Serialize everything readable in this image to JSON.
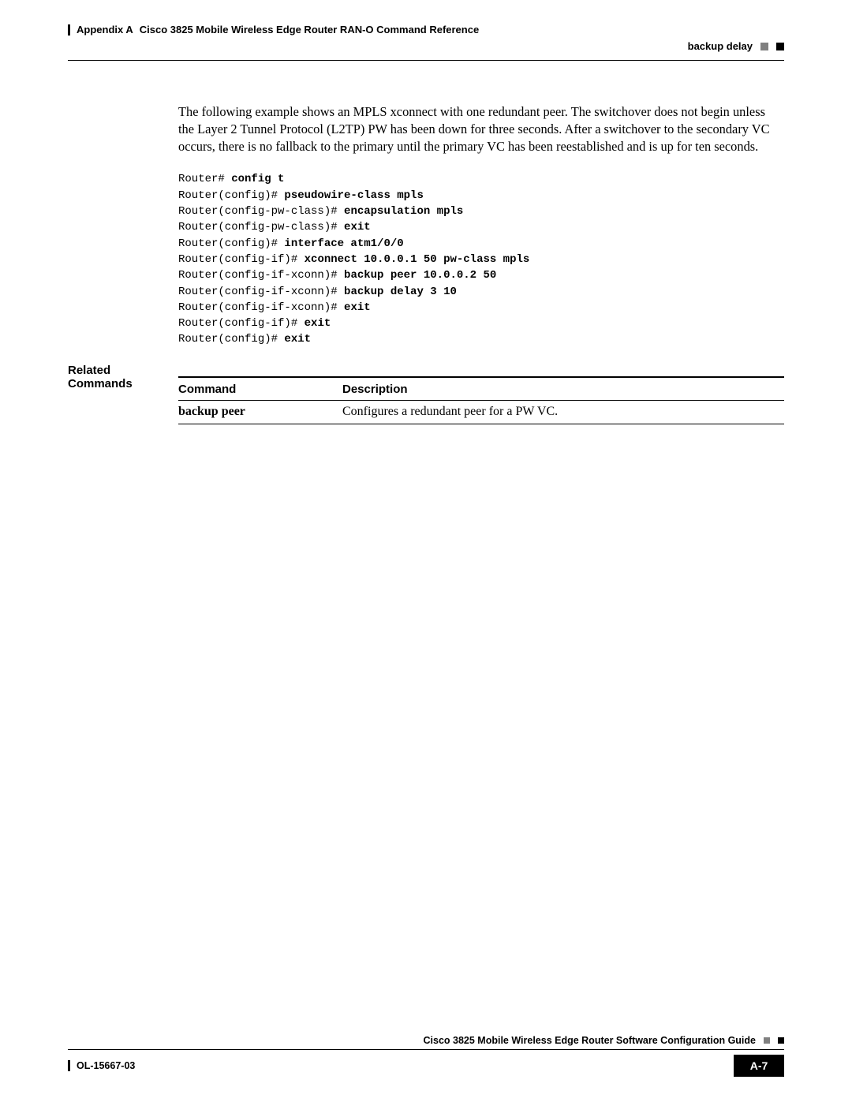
{
  "header": {
    "appendix": "Appendix A",
    "title": "Cisco 3825 Mobile Wireless Edge Router RAN-O Command Reference",
    "section": "backup delay"
  },
  "body": {
    "paragraph": "The following example shows an MPLS xconnect with one redundant peer. The switchover does not begin unless the Layer 2 Tunnel Protocol (L2TP) PW has been down for three seconds. After a switchover to the secondary VC occurs, there is no fallback to the primary until the primary VC has been reestablished and is up for ten seconds.",
    "code_lines": [
      {
        "prompt": "Router# ",
        "cmd": "config t"
      },
      {
        "prompt": "Router(config)# ",
        "cmd": "pseudowire-class mpls"
      },
      {
        "prompt": "Router(config-pw-class)# ",
        "cmd": "encapsulation mpls"
      },
      {
        "prompt": "Router(config-pw-class)# ",
        "cmd": "exit"
      },
      {
        "prompt": "Router(config)# ",
        "cmd": "interface atm1/0/0"
      },
      {
        "prompt": "Router(config-if)# ",
        "cmd": "xconnect 10.0.0.1 50 pw-class mpls"
      },
      {
        "prompt": "Router(config-if-xconn)# ",
        "cmd": "backup peer 10.0.0.2 50"
      },
      {
        "prompt": "Router(config-if-xconn)# ",
        "cmd": "backup delay 3 10"
      },
      {
        "prompt": "Router(config-if-xconn)# ",
        "cmd": "exit"
      },
      {
        "prompt": "Router(config-if)# ",
        "cmd": "exit"
      },
      {
        "prompt": "Router(config)# ",
        "cmd": "exit"
      }
    ],
    "related_label": "Related Commands",
    "table": {
      "head_command": "Command",
      "head_description": "Description",
      "rows": [
        {
          "command": "backup peer",
          "description": "Configures a redundant peer for a PW VC."
        }
      ]
    }
  },
  "footer": {
    "guide": "Cisco 3825 Mobile Wireless Edge Router Software Configuration Guide",
    "docnum": "OL-15667-03",
    "pagenum": "A-7"
  }
}
